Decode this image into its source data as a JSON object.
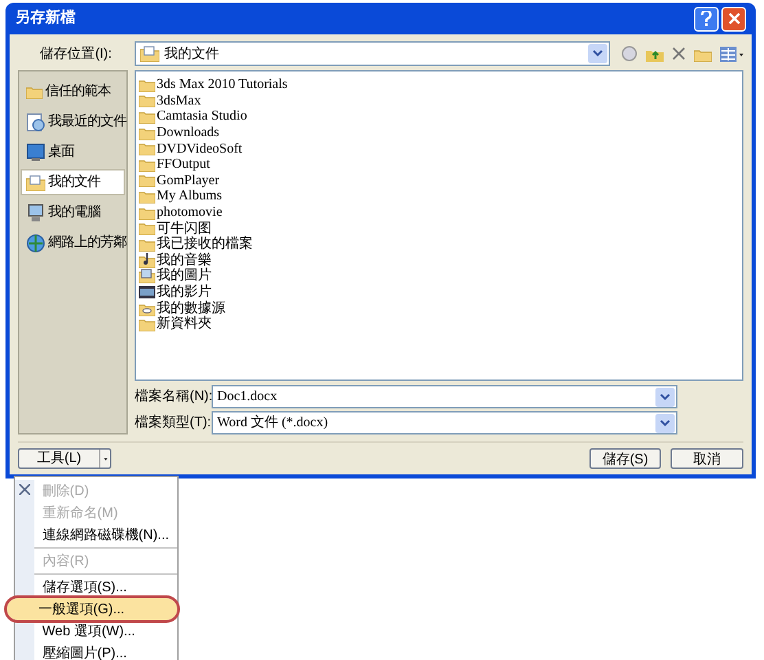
{
  "window": {
    "title": "另存新檔"
  },
  "location": {
    "label": "儲存位置(I):",
    "value": "我的文件"
  },
  "sidebar": {
    "items": [
      {
        "label": "信任的範本",
        "kind": "folder",
        "selected": false
      },
      {
        "label": "我最近的文件",
        "kind": "recent",
        "selected": false
      },
      {
        "label": "桌面",
        "kind": "desktop",
        "selected": false
      },
      {
        "label": "我的文件",
        "kind": "documents",
        "selected": true
      },
      {
        "label": "我的電腦",
        "kind": "computer",
        "selected": false
      },
      {
        "label": "網路上的芳鄰",
        "kind": "network",
        "selected": false
      }
    ]
  },
  "files": [
    {
      "name": "3ds Max 2010 Tutorials",
      "kind": "folder"
    },
    {
      "name": "3dsMax",
      "kind": "folder"
    },
    {
      "name": "Camtasia Studio",
      "kind": "folder"
    },
    {
      "name": "Downloads",
      "kind": "folder"
    },
    {
      "name": "DVDVideoSoft",
      "kind": "folder"
    },
    {
      "name": "FFOutput",
      "kind": "folder"
    },
    {
      "name": "GomPlayer",
      "kind": "folder"
    },
    {
      "name": "My Albums",
      "kind": "folder"
    },
    {
      "name": "photomovie",
      "kind": "folder"
    },
    {
      "name": "可牛闪图",
      "kind": "folder"
    },
    {
      "name": "我已接收的檔案",
      "kind": "folder"
    },
    {
      "name": "我的音樂",
      "kind": "music"
    },
    {
      "name": "我的圖片",
      "kind": "pictures"
    },
    {
      "name": "我的影片",
      "kind": "video"
    },
    {
      "name": "我的數據源",
      "kind": "datasource"
    },
    {
      "name": "新資料夾",
      "kind": "folder"
    }
  ],
  "file_name": {
    "label": "檔案名稱(N):",
    "value": "Doc1.docx"
  },
  "file_type": {
    "label": "檔案類型(T):",
    "value": "Word 文件 (*.docx)"
  },
  "tools_button": "工具(L)",
  "save_button": "儲存(S)",
  "cancel_button": "取消",
  "tools_menu": [
    {
      "label": "刪除(D)",
      "disabled": true,
      "selected": false,
      "circled": false
    },
    {
      "label": "重新命名(M)",
      "disabled": true,
      "selected": false,
      "circled": false
    },
    {
      "label": "連線網路磁碟機(N)...",
      "disabled": false,
      "selected": false,
      "circled": false
    },
    {
      "kind": "separator"
    },
    {
      "label": "內容(R)",
      "disabled": true,
      "selected": false,
      "circled": false
    },
    {
      "kind": "separator"
    },
    {
      "label": "儲存選項(S)...",
      "disabled": false,
      "selected": false,
      "circled": false
    },
    {
      "label": "一般選項(G)...",
      "disabled": false,
      "selected": true,
      "circled": true
    },
    {
      "label": "Web 選項(W)...",
      "disabled": false,
      "selected": false,
      "circled": false
    },
    {
      "label": "壓縮圖片(P)...",
      "disabled": false,
      "selected": false,
      "circled": false
    }
  ]
}
